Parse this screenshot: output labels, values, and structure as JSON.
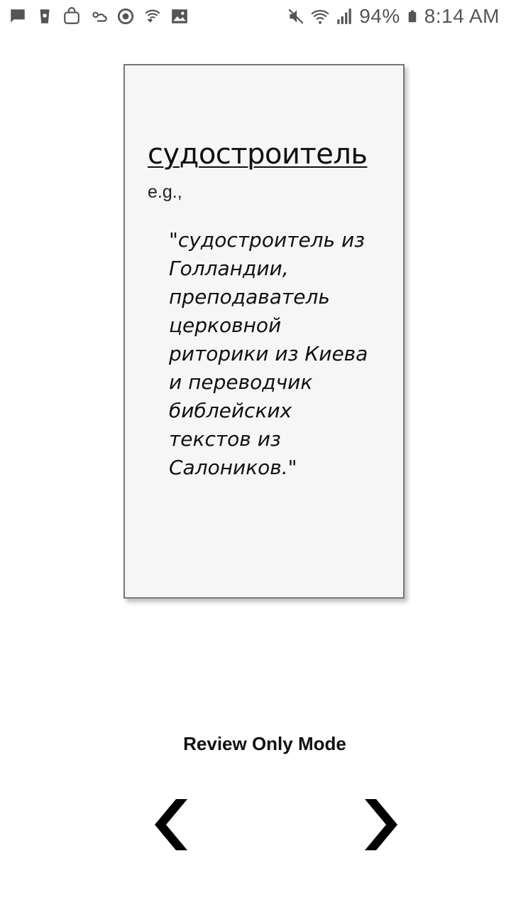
{
  "status_bar": {
    "left_icons": [
      "message-icon",
      "coffee-cup-icon",
      "shopping-bag-icon",
      "weather-icon",
      "sync-icon",
      "wifi-call-icon",
      "image-icon"
    ],
    "right_icons": [
      "mute-icon",
      "wifi-icon",
      "signal-icon",
      "battery-icon"
    ],
    "battery": "94%",
    "time": "8:14 AM"
  },
  "card": {
    "term": "судостроитель",
    "eg_label": "e.g.,",
    "example": "\"судостроитель из Голландии, преподаватель церковной риторики из Киева и переводчик библейских текстов из Салоников.\""
  },
  "footer": {
    "mode_label": "Review Only Mode",
    "prev_icon": "chevron-left-icon",
    "next_icon": "chevron-right-icon"
  }
}
